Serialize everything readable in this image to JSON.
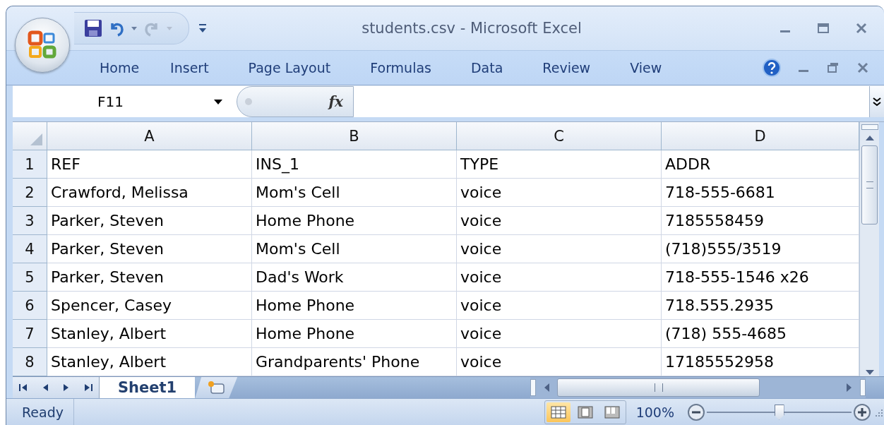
{
  "window": {
    "title": "students.csv - Microsoft Excel"
  },
  "ribbon_tabs": [
    "Home",
    "Insert",
    "Page Layout",
    "Formulas",
    "Data",
    "Review",
    "View"
  ],
  "formula_bar": {
    "name_box": "F11",
    "function_label": "fx"
  },
  "columns": [
    "A",
    "B",
    "C",
    "D"
  ],
  "rows": [
    {
      "number": "1",
      "cells": [
        "REF",
        "INS_1",
        "TYPE",
        "ADDR"
      ]
    },
    {
      "number": "2",
      "cells": [
        "Crawford, Melissa",
        "Mom's Cell",
        "voice",
        "718-555-6681"
      ]
    },
    {
      "number": "3",
      "cells": [
        "Parker, Steven",
        "Home Phone",
        "voice",
        "7185558459"
      ]
    },
    {
      "number": "4",
      "cells": [
        "Parker, Steven",
        "Mom's Cell",
        "voice",
        "(718)555/3519"
      ]
    },
    {
      "number": "5",
      "cells": [
        "Parker, Steven",
        "Dad's Work",
        "voice",
        "718-555-1546 x26"
      ]
    },
    {
      "number": "6",
      "cells": [
        "Spencer, Casey",
        "Home Phone",
        "voice",
        "718.555.2935"
      ]
    },
    {
      "number": "7",
      "cells": [
        "Stanley, Albert",
        "Home Phone",
        "voice",
        "(718) 555-4685"
      ]
    },
    {
      "number": "8",
      "cells": [
        "Stanley, Albert",
        "Grandparents' Phone",
        "voice",
        "17185552958"
      ]
    }
  ],
  "sheet_tabs": [
    {
      "label": "Sheet1",
      "selected": true
    }
  ],
  "status_bar": {
    "status": "Ready",
    "view_buttons": [
      {
        "kind": "normal",
        "selected": true
      },
      {
        "kind": "page_layout",
        "selected": false
      },
      {
        "kind": "page_break",
        "selected": false
      }
    ],
    "zoom": "100%",
    "zoom_slider": {
      "level": 0.5
    }
  }
}
